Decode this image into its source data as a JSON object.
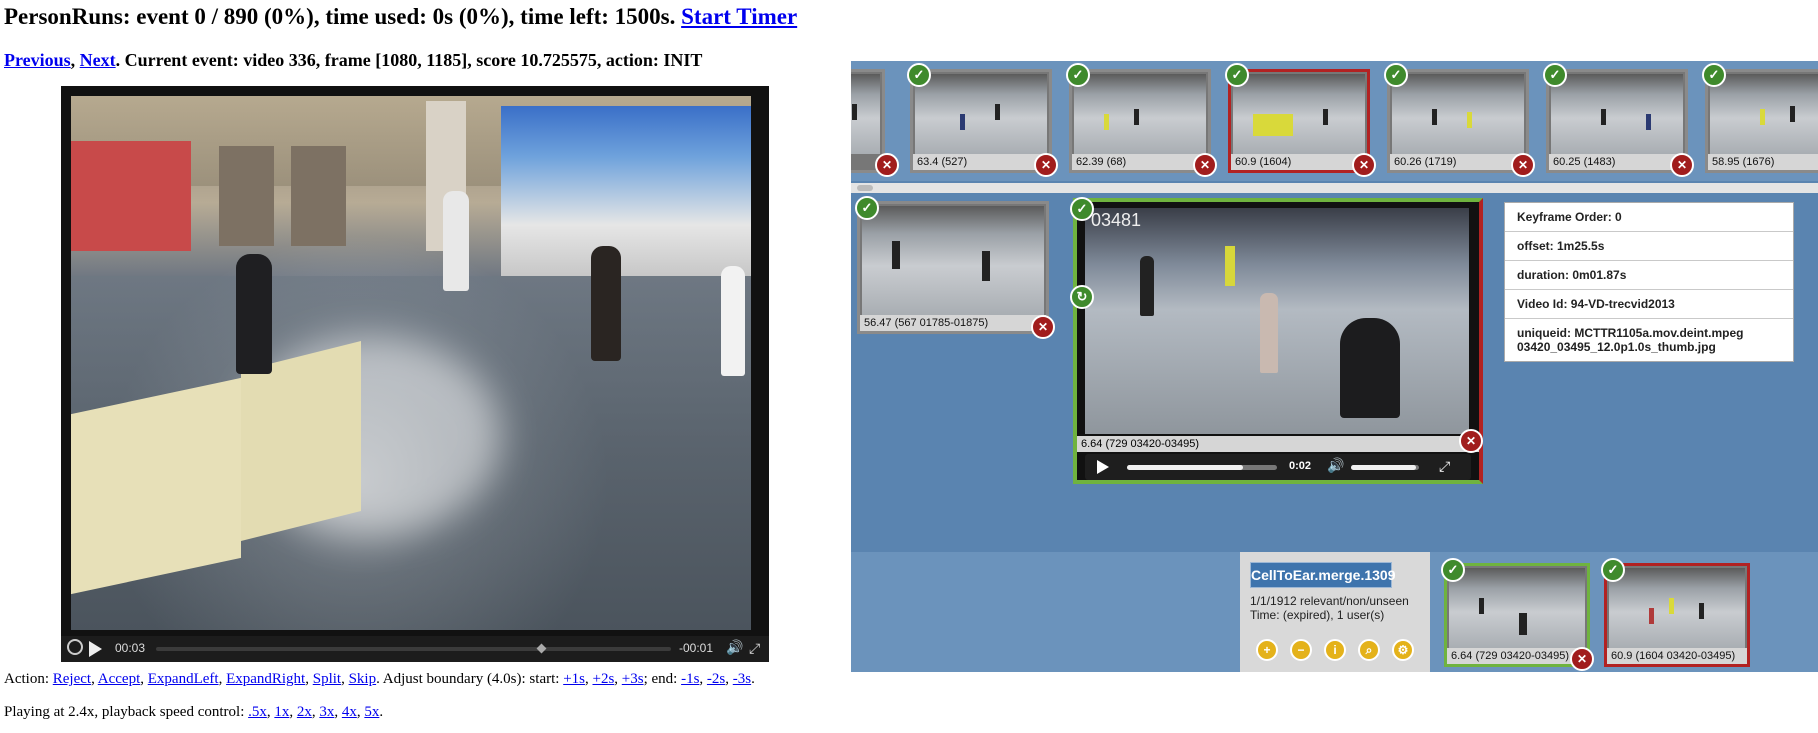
{
  "header": {
    "prefix": "PersonRuns: event 0 / 890 (0%), time used: 0s (0%), time left: 1500s.",
    "start_timer": "Start Timer"
  },
  "event_line": {
    "previous": "Previous",
    "sep": ",",
    "next": "Next",
    "text": ". Current event: video 336, frame [1080, 1185], score 10.725575, action: INIT"
  },
  "player": {
    "elapsed": "00:03",
    "remaining": "-00:01",
    "progress_fraction": 0.75
  },
  "action_line": {
    "label": "Action:",
    "links": [
      "Reject",
      "Accept",
      "ExpandLeft",
      "ExpandRight",
      "Split",
      "Skip"
    ],
    "adjust_text": ". Adjust boundary (4.0s): start:",
    "start_links": [
      "+1s",
      "+2s",
      "+3s"
    ],
    "end_label": "; end:",
    "end_links": [
      "-1s",
      "-2s",
      "-3s"
    ],
    "end_punct": "."
  },
  "speed_line": {
    "label": "Playing at 2.4x, playback speed control:",
    "links": [
      ".5x",
      "1x",
      "2x",
      "3x",
      "4x",
      "5x"
    ],
    "end_punct": "."
  },
  "right_panel": {
    "top_strip": [
      {
        "caption": "",
        "border": "gray"
      },
      {
        "caption": "63.4 (527)",
        "border": "gray"
      },
      {
        "caption": "62.39 (68)",
        "border": "gray"
      },
      {
        "caption": "60.9 (1604)",
        "border": "red"
      },
      {
        "caption": "60.26 (1719)",
        "border": "gray"
      },
      {
        "caption": "60.25 (1483)",
        "border": "gray"
      },
      {
        "caption": "58.95 (1676)",
        "border": "gray"
      }
    ],
    "left_thumb": {
      "caption": "56.47 (567 01785-01875)"
    },
    "main_thumb": {
      "overlay": "03481",
      "caption": "6.64 (729 03420-03495)",
      "time": "0:02",
      "progress_fraction": 0.77,
      "volume_fraction": 0.95
    },
    "info": {
      "keyframe_order": "Keyframe Order: 0",
      "offset": "offset: 1m25.5s",
      "duration": "duration: 0m01.87s",
      "video_id": "Video Id: 94-VD-trecvid2013",
      "uniqueid": "uniqueid: MCTTR1105a.mov.deint.mpeg 03420_03495_12.0p1.0s_thumb.jpg"
    },
    "cluster": {
      "title": "CellToEar.merge.1309",
      "stats1": "1/1/1912 relevant/non/unseen",
      "stats2": "Time: (expired), 1 user(s)"
    },
    "bottom_thumbs": [
      {
        "caption": "6.64 (729 03420-03495)",
        "border": "green"
      },
      {
        "caption": "60.9 (1604 03420-03495)",
        "border": "red"
      }
    ]
  }
}
